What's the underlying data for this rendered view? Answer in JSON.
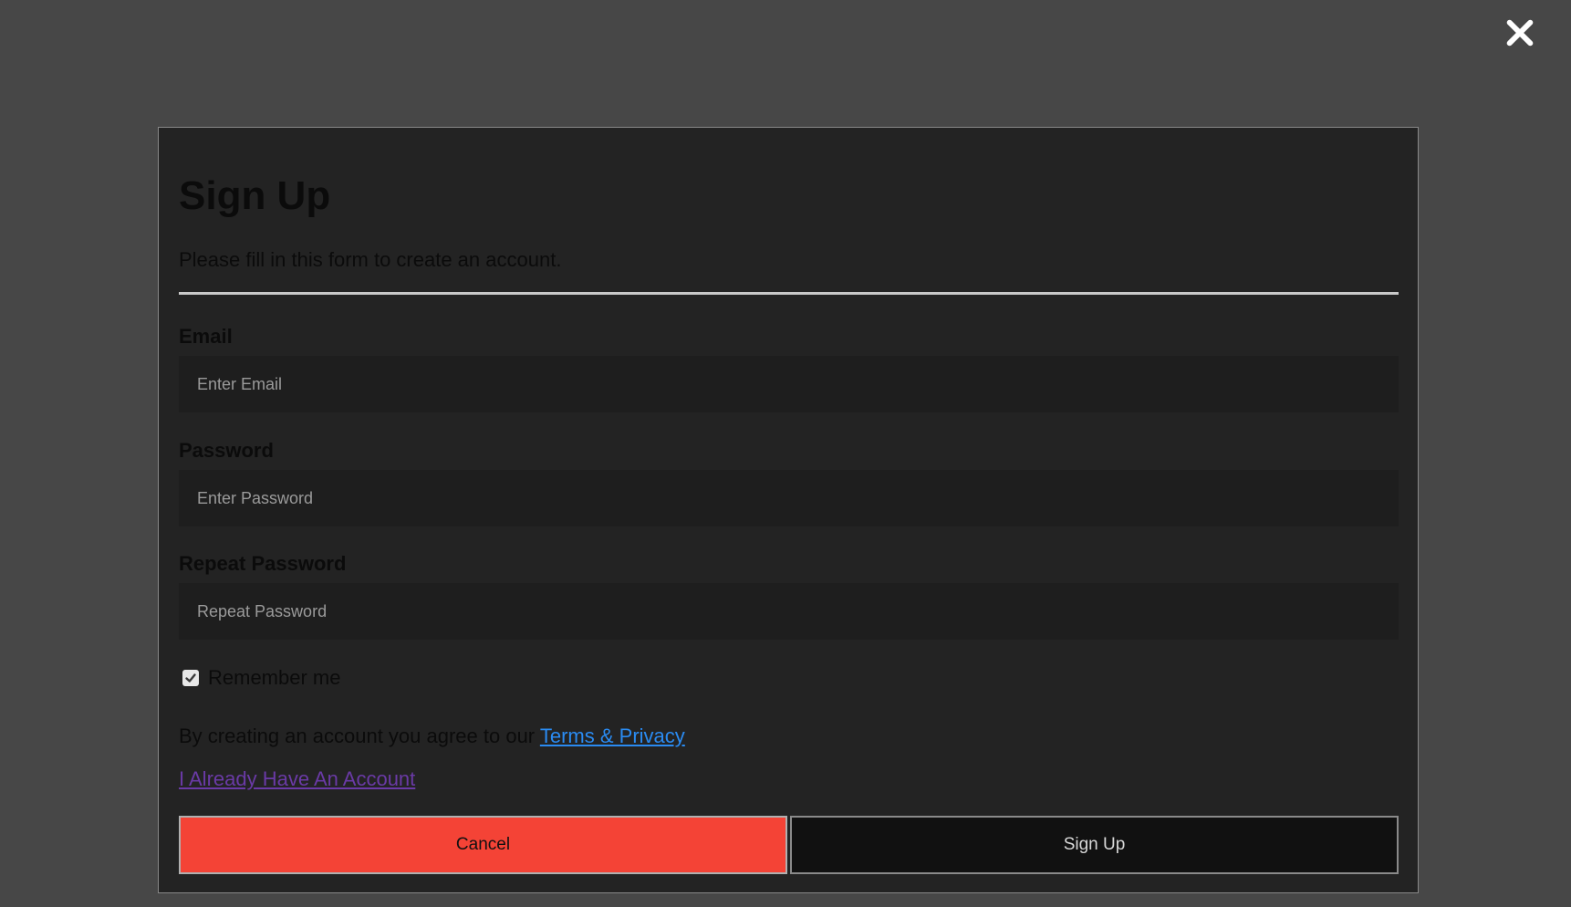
{
  "close": {
    "icon": "close-icon"
  },
  "form": {
    "title": "Sign Up",
    "subtitle": "Please fill in this form to create an account.",
    "email": {
      "label": "Email",
      "placeholder": "Enter Email",
      "value": ""
    },
    "password": {
      "label": "Password",
      "placeholder": "Enter Password",
      "value": ""
    },
    "repeat_password": {
      "label": "Repeat Password",
      "placeholder": "Repeat Password",
      "value": ""
    },
    "remember": {
      "label": "Remember me",
      "checked": true
    },
    "terms": {
      "prefix": "By creating an account you agree to our ",
      "link_text": "Terms & Privacy"
    },
    "account_link": "I Already Have An Account",
    "buttons": {
      "cancel": "Cancel",
      "signup": "Sign Up"
    }
  },
  "colors": {
    "overlay": "#474747",
    "modal_bg": "#232323",
    "cancel_bg": "#f44336",
    "signup_bg": "#111111",
    "link_blue": "#2a8bf2",
    "link_visited": "#6a3aa6"
  }
}
